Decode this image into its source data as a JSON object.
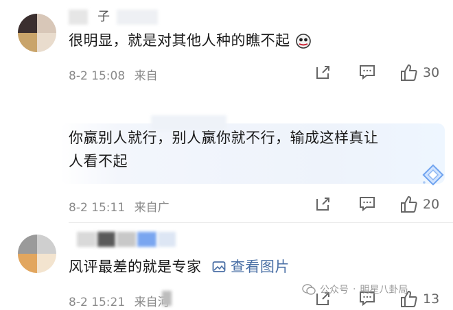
{
  "comments": [
    {
      "username": "子",
      "text": "很明显，就是对其他人种的瞧不起",
      "emoji": "face-icon",
      "date": "8-2 15:08",
      "location": "来自",
      "likes": "30"
    },
    {
      "username": "",
      "text_line1": "你赢别人就行，别人赢你就不行，输成这样真让",
      "text_line2": "人看不起",
      "date": "8-2 15:11",
      "location": "来自广",
      "likes": "20"
    },
    {
      "username": "",
      "text": "风评最差的就是专家",
      "image_link": "查看图片",
      "date": "8-2 15:21",
      "location": "来自河",
      "likes": "13"
    }
  ],
  "watermark": {
    "account_type": "公众号",
    "separator": "·",
    "account_name": "明星八卦局"
  }
}
